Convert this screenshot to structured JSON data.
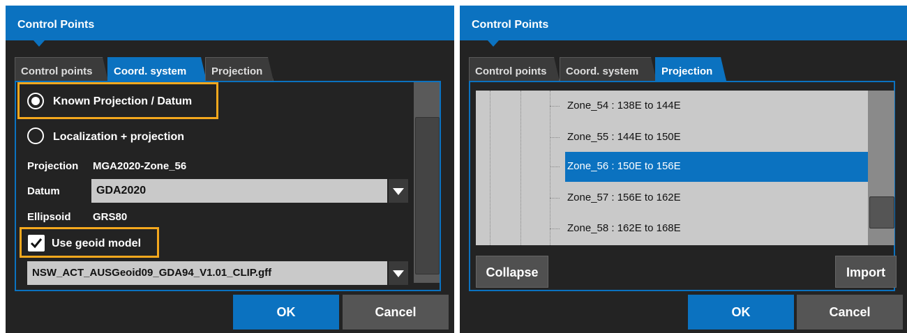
{
  "left": {
    "title": "Control Points",
    "tabs": [
      "Control points",
      "Coord. system",
      "Projection"
    ],
    "active_tab": "Coord. system",
    "options": {
      "known": "Known Projection / Datum",
      "localization": "Localization + projection"
    },
    "projection": {
      "label": "Projection",
      "value": "MGA2020-Zone_56"
    },
    "datum": {
      "label": "Datum",
      "value": "GDA2020"
    },
    "ellipsoid": {
      "label": "Ellipsoid",
      "value": "GRS80"
    },
    "geoid": {
      "label": "Use geoid model",
      "checked": true,
      "file": "NSW_ACT_AUSGeoid09_GDA94_V1.01_CLIP.gff"
    },
    "ok": "OK",
    "cancel": "Cancel"
  },
  "right": {
    "title": "Control Points",
    "tabs": [
      "Control points",
      "Coord. system",
      "Projection"
    ],
    "active_tab": "Projection",
    "zones": [
      "Zone_54 : 138E to 144E",
      "Zone_55 : 144E to 150E",
      "Zone_56 : 150E to 156E",
      "Zone_57 : 156E to 162E",
      "Zone_58 : 162E to 168E"
    ],
    "selected_zone": "Zone_56 : 150E to 156E",
    "collapse": "Collapse",
    "import": "Import",
    "ok": "OK",
    "cancel": "Cancel"
  },
  "colors": {
    "accent": "#0b72c0",
    "highlight": "#f5a81d",
    "panel": "#232323"
  }
}
